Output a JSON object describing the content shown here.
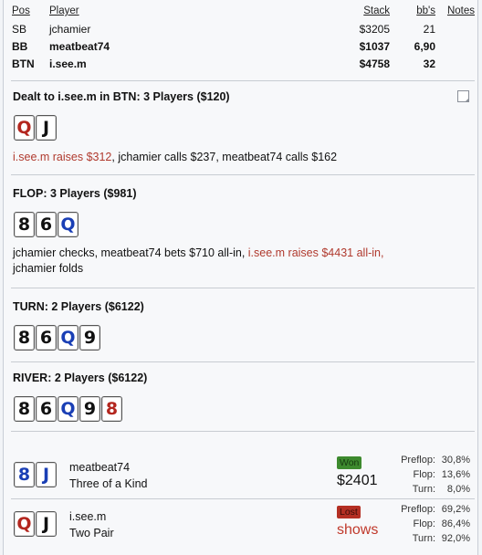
{
  "players_table": {
    "headers": {
      "pos": "Pos",
      "player": "Player",
      "stack": "Stack",
      "bbs": "bb's",
      "notes": "Notes"
    },
    "rows": [
      {
        "pos": "SB",
        "player": "jchamier",
        "stack": "$3205",
        "bbs": "21",
        "bold": false
      },
      {
        "pos": "BB",
        "player": "meatbeat74",
        "stack": "$1037",
        "bbs": "6,90",
        "bold": true
      },
      {
        "pos": "BTN",
        "player": "i.see.m",
        "stack": "$4758",
        "bbs": "32",
        "bold": true
      }
    ]
  },
  "preflop": {
    "title": "Dealt to i.see.m in BTN: 3 Players ($120)",
    "cards": [
      {
        "rank": "Q",
        "suit": "h"
      },
      {
        "rank": "J",
        "suit": "s"
      }
    ],
    "action_hero": "i.see.m raises $312",
    "action_rest": ", jchamier calls $237, meatbeat74 calls $162"
  },
  "flop": {
    "title": "FLOP: 3 Players ($981)",
    "cards": [
      {
        "rank": "8",
        "suit": "s"
      },
      {
        "rank": "6",
        "suit": "s"
      },
      {
        "rank": "Q",
        "suit": "d"
      }
    ],
    "action_pre": "jchamier checks, meatbeat74 bets $710 all-in, ",
    "action_hero": "i.see.m raises $4431 all-in,",
    "action_post": "jchamier folds"
  },
  "turn": {
    "title": "TURN: 2 Players ($6122)",
    "cards": [
      {
        "rank": "8",
        "suit": "s"
      },
      {
        "rank": "6",
        "suit": "s"
      },
      {
        "rank": "Q",
        "suit": "d"
      },
      {
        "rank": "9",
        "suit": "s"
      }
    ]
  },
  "river": {
    "title": "RIVER: 2 Players ($6122)",
    "cards": [
      {
        "rank": "8",
        "suit": "s"
      },
      {
        "rank": "6",
        "suit": "s"
      },
      {
        "rank": "Q",
        "suit": "d"
      },
      {
        "rank": "9",
        "suit": "s"
      },
      {
        "rank": "8",
        "suit": "h"
      }
    ]
  },
  "results": [
    {
      "player": "meatbeat74",
      "hand": "Three of a Kind",
      "cards": [
        {
          "rank": "8",
          "suit": "d"
        },
        {
          "rank": "J",
          "suit": "d"
        }
      ],
      "badge": "Won",
      "badge_type": "won",
      "amount": "$2401",
      "equity": {
        "preflop_label": "Preflop:",
        "preflop": "30,8%",
        "flop_label": "Flop:",
        "flop": "13,6%",
        "turn_label": "Turn:",
        "turn": "8,0%"
      }
    },
    {
      "player": "i.see.m",
      "hand": "Two Pair",
      "cards": [
        {
          "rank": "Q",
          "suit": "h"
        },
        {
          "rank": "J",
          "suit": "s"
        }
      ],
      "badge": "Lost",
      "badge_type": "lost",
      "amount": "shows",
      "equity": {
        "preflop_label": "Preflop:",
        "preflop": "69,2%",
        "flop_label": "Flop:",
        "flop": "86,4%",
        "turn_label": "Turn:",
        "turn": "92,0%"
      }
    }
  ],
  "colors": {
    "hero_red": "#b03a2e",
    "won_green": "#3d8a2e",
    "lost_red": "#b42f23",
    "diamond_blue": "#1a3fb5"
  },
  "icons": {
    "corner": "replay-icon"
  }
}
